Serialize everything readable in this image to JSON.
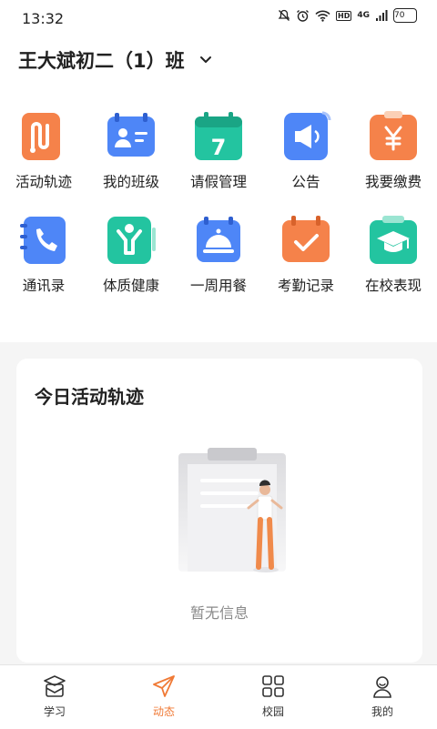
{
  "status_bar": {
    "time": "13:32",
    "network": "4G",
    "hd": "HD",
    "battery": "70"
  },
  "header": {
    "class_name": "王大斌初二（1）班"
  },
  "menu": {
    "items": [
      {
        "label": "活动轨迹",
        "icon": "activity-track-icon",
        "color": "#f5824a"
      },
      {
        "label": "我的班级",
        "icon": "class-card-icon",
        "color": "#4e86f7"
      },
      {
        "label": "请假管理",
        "icon": "calendar-7-icon",
        "color": "#23c4a0"
      },
      {
        "label": "公告",
        "icon": "megaphone-icon",
        "color": "#4e86f7"
      },
      {
        "label": "我要缴费",
        "icon": "yen-payment-icon",
        "color": "#f5824a"
      },
      {
        "label": "通讯录",
        "icon": "phone-book-icon",
        "color": "#4e86f7"
      },
      {
        "label": "体质健康",
        "icon": "fitness-person-icon",
        "color": "#23c4a0"
      },
      {
        "label": "一周用餐",
        "icon": "meal-cloche-icon",
        "color": "#4e86f7"
      },
      {
        "label": "考勤记录",
        "icon": "attendance-check-icon",
        "color": "#f5824a"
      },
      {
        "label": "在校表现",
        "icon": "graduation-cap-icon",
        "color": "#23c4a0"
      }
    ]
  },
  "activity_card": {
    "title": "今日活动轨迹",
    "empty_text": "暂无信息"
  },
  "tabbar": {
    "tabs": [
      {
        "label": "学习",
        "icon": "study-icon",
        "active": false
      },
      {
        "label": "动态",
        "icon": "paper-plane-icon",
        "active": true
      },
      {
        "label": "校园",
        "icon": "campus-grid-icon",
        "active": false
      },
      {
        "label": "我的",
        "icon": "profile-icon",
        "active": false
      }
    ]
  },
  "colors": {
    "accent": "#f07a36",
    "blue": "#4e86f7",
    "teal": "#23c4a0",
    "orange": "#f5824a"
  }
}
